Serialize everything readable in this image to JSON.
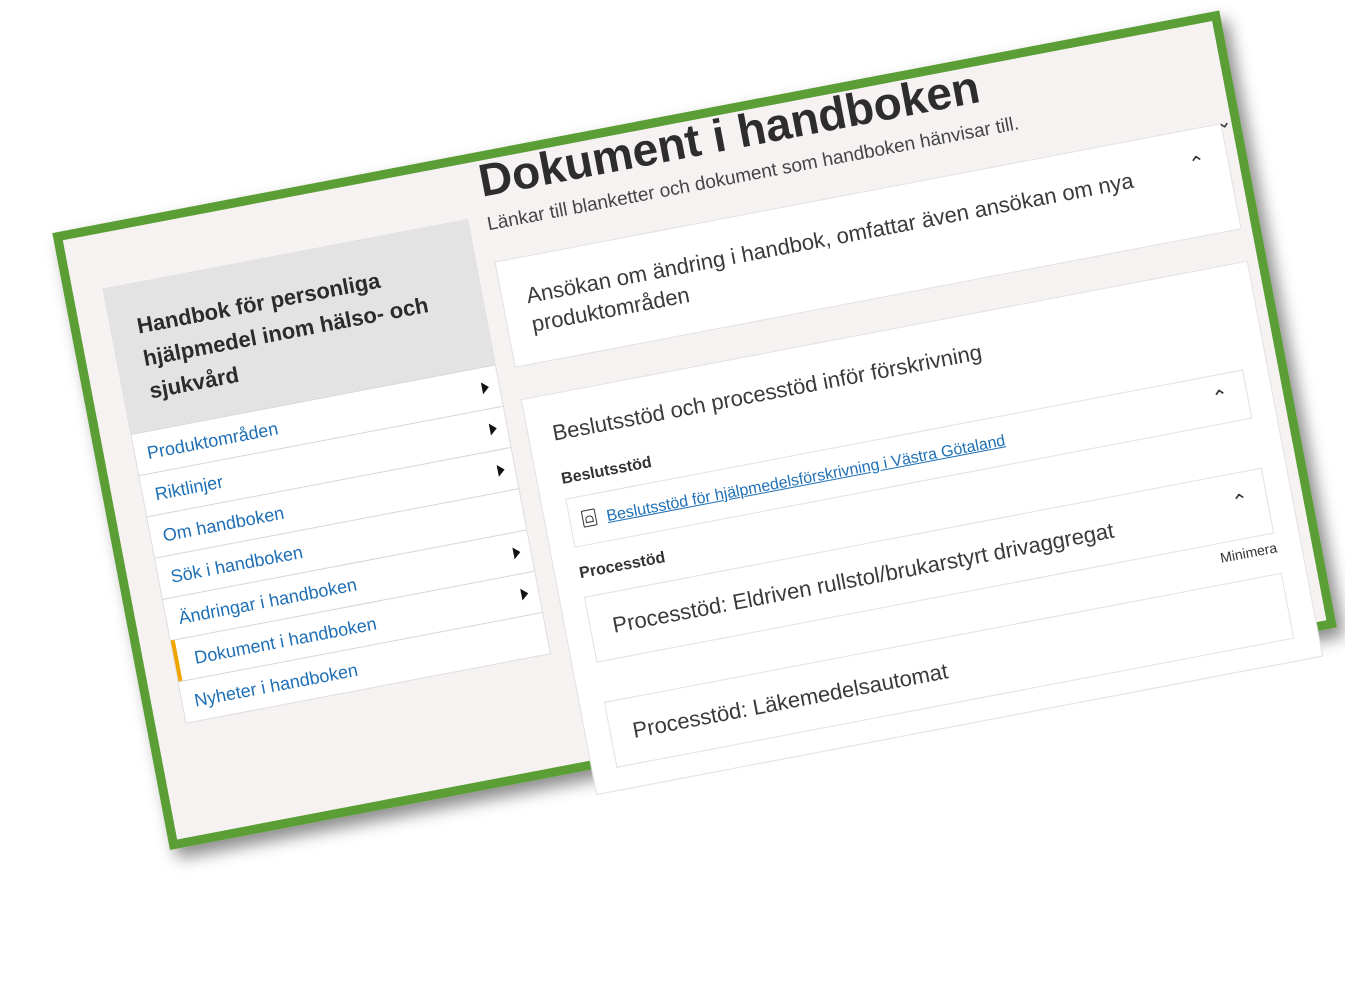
{
  "sidebar": {
    "title": "Handbok för personliga hjälpmedel inom hälso- och sjukvård",
    "items": [
      {
        "label": "Produktområden"
      },
      {
        "label": "Riktlinjer"
      },
      {
        "label": "Om handboken"
      },
      {
        "label": "Sök i handboken"
      },
      {
        "label": "Ändringar i handboken"
      },
      {
        "label": "Dokument i handboken"
      },
      {
        "label": "Nyheter i handboken"
      }
    ]
  },
  "main": {
    "title": "Dokument i handboken",
    "lead": "Länkar till blanketter och dokument som handboken hänvisar till.",
    "accordion1": {
      "title": "Ansökan om ändring i handbok, omfattar även ansökan om nya produktområden"
    },
    "accordion2": {
      "title": "Beslutsstöd och processtöd inför förskrivning",
      "beslutsstod_label": "Beslutsstöd",
      "beslutsstod_link": "Beslutsstöd för hjälpmedelsförskrivning i Västra Götaland",
      "processtod_label": "Processtöd",
      "sub1": {
        "title": "Processtöd: Eldriven rullstol/brukarstyrt drivaggregat"
      },
      "sub2": {
        "title": "Processtöd: Läkemedelsautomat"
      },
      "minimize_label": "Minimera"
    }
  },
  "colors": {
    "frame_border": "#5b9e36",
    "link": "#1f6fb5",
    "active_marker": "#f0a400"
  }
}
